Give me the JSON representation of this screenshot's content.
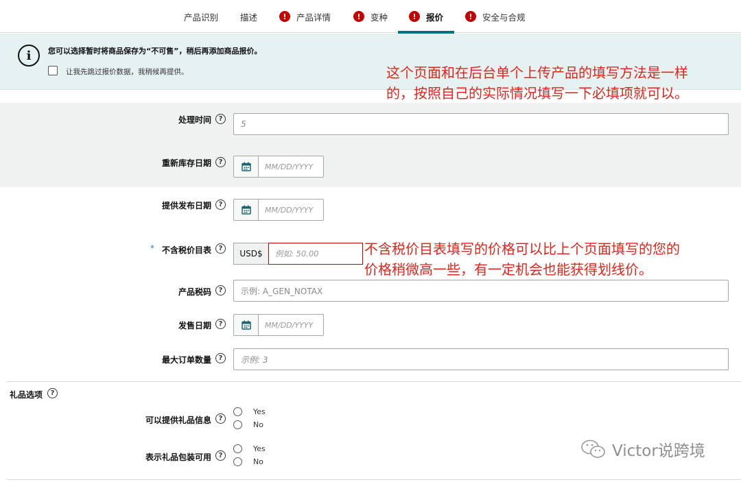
{
  "tabs": [
    {
      "label": "产品识别",
      "error": false,
      "active": false
    },
    {
      "label": "描述",
      "error": false,
      "active": false
    },
    {
      "label": "产品详情",
      "error": true,
      "active": false
    },
    {
      "label": "变种",
      "error": true,
      "active": false
    },
    {
      "label": "报价",
      "error": true,
      "active": true
    },
    {
      "label": "安全与合规",
      "error": true,
      "active": false
    }
  ],
  "error_glyph": "!",
  "banner": {
    "icon": "info-icon",
    "title": "您可以选择暂时将商品保存为“不可售”，稍后再添加商品报价。",
    "checkbox_label": "让我先跳过报价数据，我稍候再提供。",
    "checked": false
  },
  "annotations": {
    "top_line1": "这个页面和在后台单个上传产品的填写方法是一样",
    "top_line2": "的，按照自己的实际情况填写一下必填项就可以。",
    "price_line1": "不含税价目表填写的价格可以比上个页面填写的您的",
    "price_line2": "价格稍微高一些，有一定机会也能获得划线价。"
  },
  "form": {
    "handling_time": {
      "label": "处理时间",
      "value": "5"
    },
    "restock_date": {
      "label": "重新库存日期",
      "placeholder": "MM/DD/YYYY"
    },
    "offer_release_date": {
      "label": "提供发布日期",
      "placeholder": "MM/DD/YYYY"
    },
    "list_price": {
      "label": "不含税价目表",
      "required_mark": "*",
      "currency": "USD$",
      "placeholder": "例如:  50.00"
    },
    "tax_code": {
      "label": "产品税码",
      "placeholder": "示例:  A_GEN_NOTAX"
    },
    "release_date": {
      "label": "发售日期",
      "placeholder": "MM/DD/YYYY"
    },
    "max_order_qty": {
      "label": "最大订单数量",
      "placeholder": "示例:  3"
    }
  },
  "gift": {
    "section_title": "礼品选项",
    "gift_message": {
      "label": "可以提供礼品信息",
      "options": [
        "Yes",
        "No"
      ]
    },
    "gift_wrap": {
      "label": "表示礼品包装可用",
      "options": [
        "Yes",
        "No"
      ]
    }
  },
  "help_glyph": "?",
  "watermark": {
    "text": "Victor说跨境",
    "icon": "wechat-icon"
  },
  "colors": {
    "accent": "#007185",
    "error": "#c40000",
    "annotation": "#e0251b",
    "banner_bg": "#e6f1f2"
  }
}
